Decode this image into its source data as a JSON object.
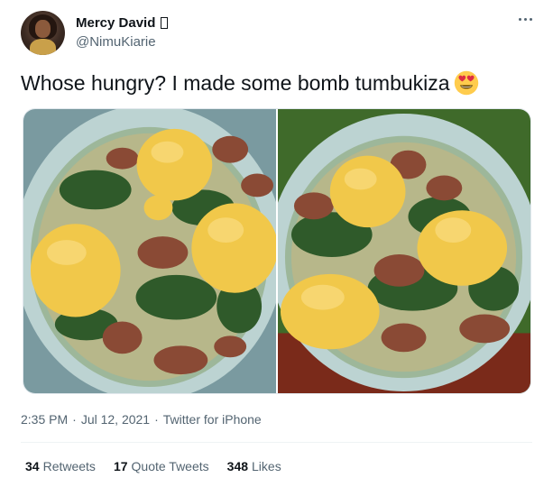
{
  "author": {
    "display_name": "Mercy David",
    "handle": "@NimuKiarie"
  },
  "tweet": {
    "text": "Whose hungry? I made some bomb tumbukiza",
    "emoji": "heart-eyes-emoji",
    "images": [
      "tumbukiza-bowl-photo-1",
      "tumbukiza-bowl-photo-2"
    ]
  },
  "meta": {
    "time": "2:35 PM",
    "sep1": "·",
    "date": "Jul 12, 2021",
    "sep2": "·",
    "source": "Twitter for iPhone"
  },
  "stats": {
    "retweets_count": "34",
    "retweets_label": "Retweets",
    "quotes_count": "17",
    "quotes_label": "Quote Tweets",
    "likes_count": "348",
    "likes_label": "Likes"
  },
  "colors": {
    "text_primary": "#0f1419",
    "text_secondary": "#536471",
    "divider": "#eff3f4"
  }
}
